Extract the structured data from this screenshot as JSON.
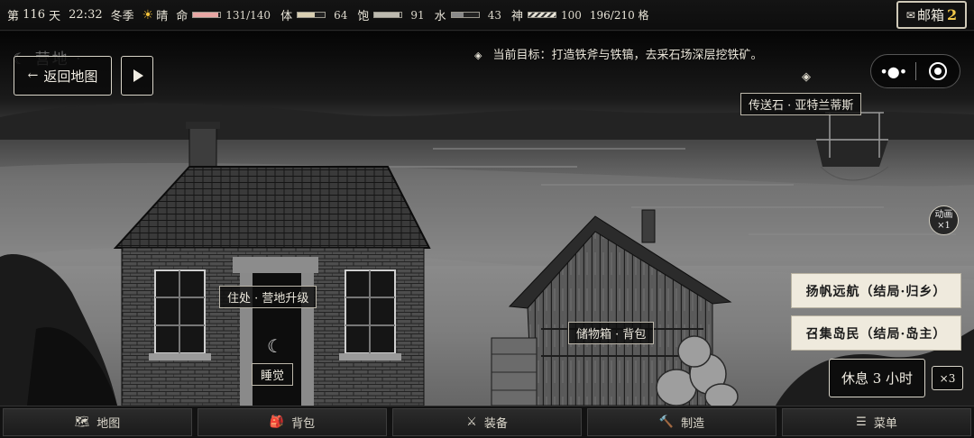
{
  "status": {
    "day_prefix": "第",
    "day": "116",
    "day_suffix": "天",
    "time": "22:32",
    "season": "冬季",
    "weather": "晴",
    "life": {
      "label": "命",
      "value": "131/140",
      "fraction": 0.936,
      "color": "#e8a7a4"
    },
    "stamina": {
      "label": "体",
      "value": "64",
      "fraction": 0.64,
      "color": "#d9cfb2"
    },
    "satiety": {
      "label": "饱",
      "value": "91",
      "fraction": 0.91,
      "color": "#bdbab0"
    },
    "water": {
      "label": "水",
      "value": "43",
      "fraction": 0.43,
      "color": "#8a8a8a"
    },
    "spirit": {
      "label": "神",
      "value": "100",
      "fraction": 1.0
    },
    "capacity": "196/210 格"
  },
  "mailbox": {
    "label": "邮箱",
    "count": "2",
    "icon": "envelope-icon"
  },
  "top_left": {
    "location_ghost": "☾ 营地 ·",
    "back_label": "返回地图",
    "back_arrow": "←"
  },
  "goal_text": "当前目标：打造铁斧与铁镐，去采石场深层挖铁矿。",
  "tags": {
    "teleport": "传送石 · 亚特兰蒂斯",
    "residence": "住处 · 营地升级",
    "sleep": "睡觉",
    "storage": "储物箱 · 背包"
  },
  "anim": {
    "line1": "动画",
    "line2": "×1"
  },
  "endings": {
    "sail": "扬帆远航（结局·归乡）",
    "islanders": "召集岛民（结局·岛主）"
  },
  "rest": {
    "label": "休息 3 小时",
    "multiplier": "×3"
  },
  "nav": [
    {
      "icon": "map-icon",
      "glyph": "🗺",
      "label": "地图"
    },
    {
      "icon": "backpack-icon",
      "glyph": "🎒",
      "label": "背包"
    },
    {
      "icon": "swords-icon",
      "glyph": "⚔",
      "label": "装备"
    },
    {
      "icon": "hammer-icon",
      "glyph": "🔨",
      "label": "制造"
    },
    {
      "icon": "menu-icon",
      "glyph": "☰",
      "label": "菜单"
    }
  ]
}
